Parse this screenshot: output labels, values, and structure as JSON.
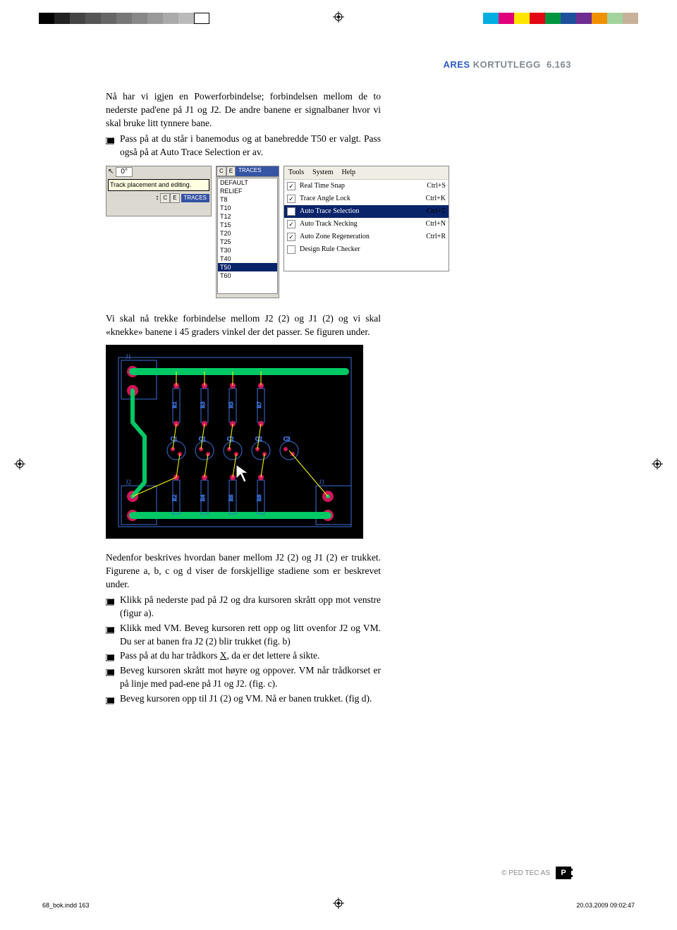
{
  "header": {
    "ares": "ARES",
    "title": "KORTUTLEGG",
    "page": "6.163"
  },
  "intro_para": "Nå har vi igjen en Powerforbindelse; forbindelsen mellom de to nederste pad'ene på J1 og J2. De andre banene er signal­baner hvor vi skal bruke litt tynnere bane.",
  "bullet1": "Pass på at du står i banemodus og at banebredde T50 er valgt. Pass også på at Auto Trace Selection er av.",
  "middle_para": "Vi skal nå trekke forbindelse mellom J2 (2) og J1 (2) og vi skal «knekke» banene i 45 graders vinkel der det pas­ser. Se figuren under.",
  "desc_para": "Nedenfor beskrives hvordan baner mellom J2 (2) og J1 (2) er trukket. Figurene a, b, c og d viser de forskjellige stadi­ene som er beskrevet under.",
  "bullets": [
    "Klikk på nederste pad på J2 og dra kursoren skrått opp mot venstre (figur a).",
    "Klikk med VM. Beveg kursoren rett opp og litt ovenfor J2 og VM. Du ser at banen fra J2 (2) blir trukket (fig. b)",
    "Pass på at du har trådkors X, da er det lettere å sikte.",
    "Beveg kursoren skrått mot høyre og oppover. VM når tråd­korset er på linje med pad-ene på J1 og J2. (fig. c).",
    "Beveg kursoren opp til J1 (2) og VM. Nå er banen trukket. (fig d)."
  ],
  "ui_panel1": {
    "angle": "0°",
    "tooltip": "Track placement and editing.",
    "ce": [
      "C",
      "E"
    ],
    "traces": "TRACES"
  },
  "ui_panel2": {
    "ce": [
      "C",
      "E"
    ],
    "traces": "TRACES",
    "items": [
      "DEFAULT",
      "RELIEF",
      "T8",
      "T10",
      "T12",
      "T15",
      "T20",
      "T25",
      "T30",
      "T40",
      "T50",
      "T60"
    ],
    "selected": "T50"
  },
  "ui_panel3": {
    "menubar": [
      "Tools",
      "System",
      "Help"
    ],
    "rows": [
      {
        "checked": true,
        "label": "Real Time Snap",
        "shortcut": "Ctrl+S"
      },
      {
        "checked": true,
        "label": "Trace Angle Lock",
        "shortcut": "Ctrl+K"
      },
      {
        "checked": false,
        "label": "Auto Trace Selection",
        "shortcut": "Ctrl+T",
        "selected": true
      },
      {
        "checked": true,
        "label": "Auto Track Necking",
        "shortcut": "Ctrl+N"
      },
      {
        "checked": true,
        "label": "Auto Zone Regeneration",
        "shortcut": "Ctrl+R"
      },
      {
        "checked": false,
        "label": "Design Rule Checker",
        "shortcut": ""
      }
    ]
  },
  "pcb": {
    "labels": [
      "J1",
      "J2",
      "J3",
      "R1",
      "R2",
      "R3",
      "R4",
      "R5",
      "R6",
      "R7",
      "R8",
      "C1",
      "Q1",
      "C2",
      "Q2",
      "C3"
    ]
  },
  "footer": {
    "copyright": "© PED TEC AS",
    "logo": "P"
  },
  "slugline": {
    "left": "68_bok.indd   163",
    "right": "20.03.2009   09:02:47"
  },
  "colorbar": {
    "left_swatches": [
      "#000",
      "#222",
      "#444",
      "#555",
      "#666",
      "#777",
      "#888",
      "#999",
      "#aaa",
      "#bbb",
      "transparent"
    ],
    "right_swatches": [
      "#00aee0",
      "#e2007a",
      "#ffe600",
      "#e30613",
      "#009640",
      "#1d4f9c",
      "#6f2c91",
      "#f29100",
      "#a2d39c",
      "#c7b299"
    ]
  }
}
